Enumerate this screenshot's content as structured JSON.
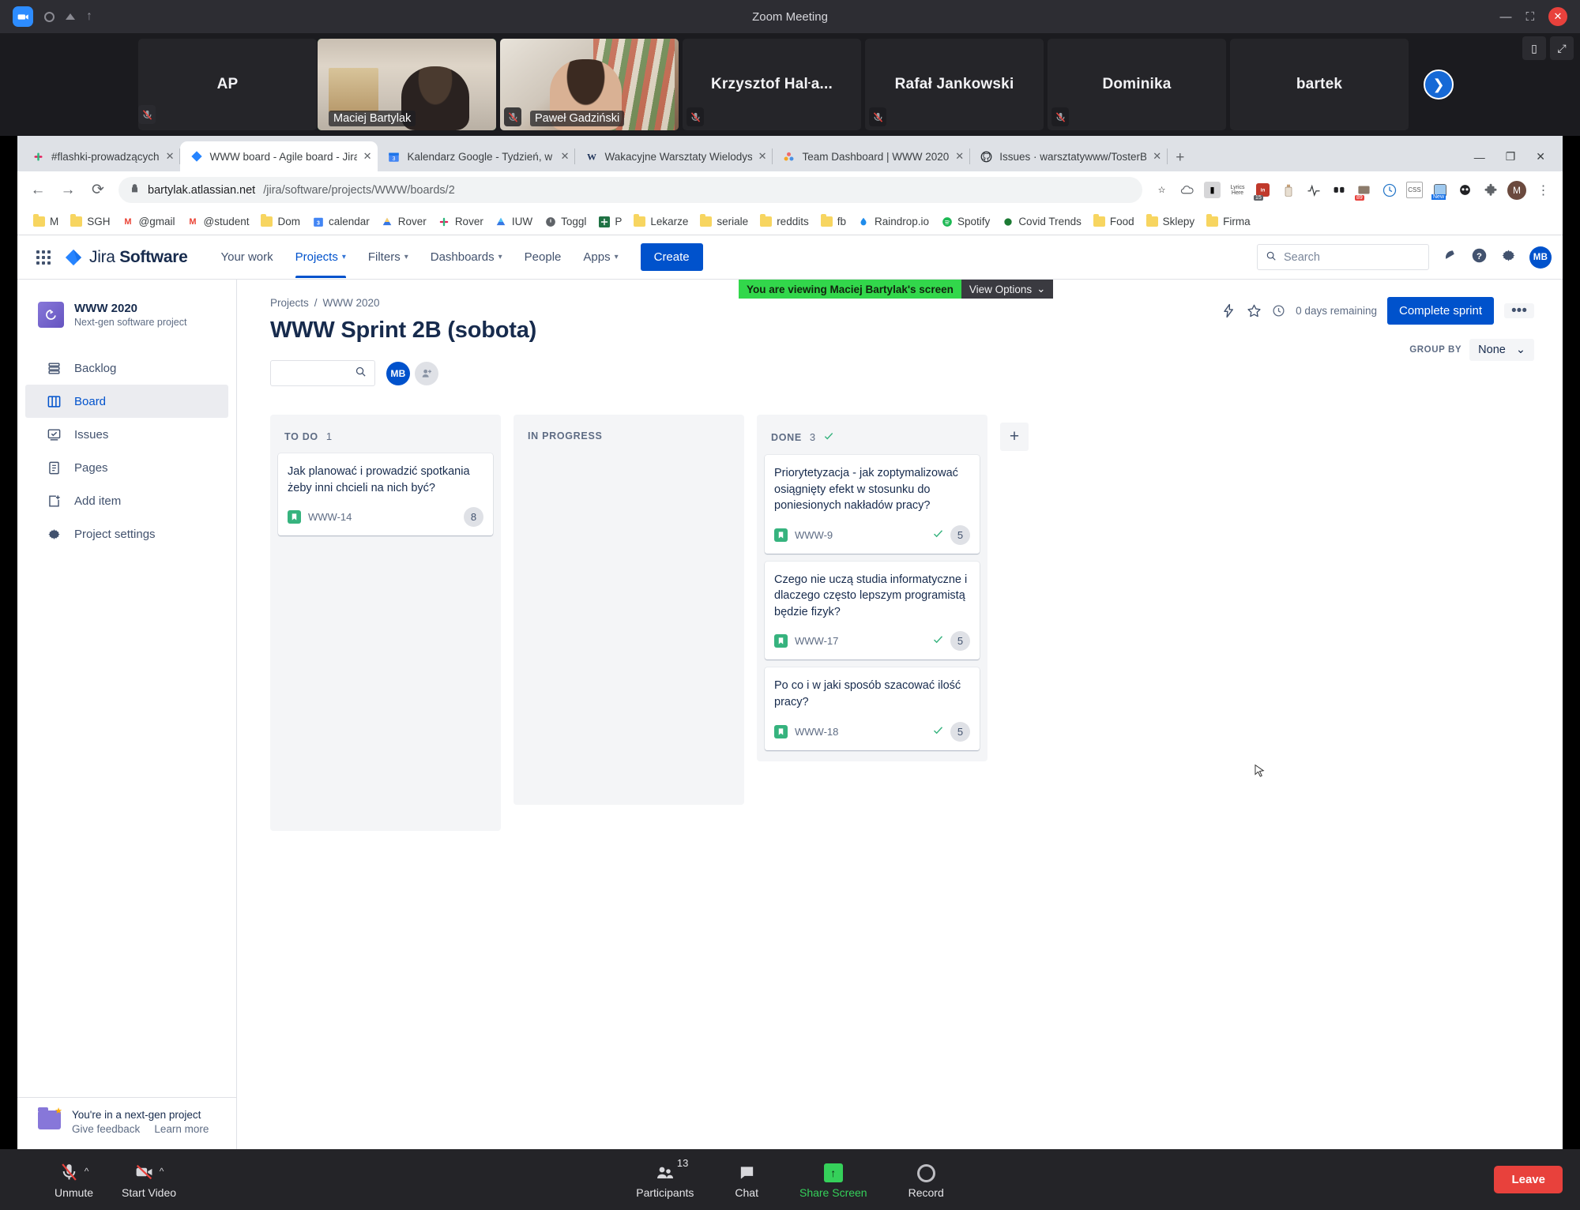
{
  "zoom": {
    "window_title": "Zoom Meeting",
    "participants": [
      {
        "name": "AP",
        "has_video": false,
        "muted": true
      },
      {
        "name": "Maciej Bartylak",
        "has_video": true,
        "muted": false,
        "active_speaker": true
      },
      {
        "name": "Paweł Gadziński",
        "has_video": true,
        "muted": true
      },
      {
        "name": "Krzysztof Haŀa...",
        "has_video": false,
        "muted": true
      },
      {
        "name": "Rafał Jankowski",
        "has_video": false,
        "muted": true
      },
      {
        "name": "Dominika",
        "has_video": false,
        "muted": true
      },
      {
        "name": "bartek",
        "has_video": false,
        "muted": true
      }
    ],
    "next_page_icon": "chevron-right-icon",
    "view_banner": {
      "text": "You are viewing Maciej Bartylak's screen",
      "options_label": "View Options",
      "accent_color": "#32d74b"
    },
    "bottom_bar": {
      "unmute_label": "Unmute",
      "start_video_label": "Start Video",
      "participants_label": "Participants",
      "participants_count": "13",
      "chat_label": "Chat",
      "share_screen_label": "Share Screen",
      "record_label": "Record",
      "leave_label": "Leave",
      "leave_color": "#e8413c",
      "share_color": "#35d05a"
    }
  },
  "browser": {
    "tabs": [
      {
        "title": "#flashki-prowadzących",
        "favicon": "slack-icon",
        "active": false
      },
      {
        "title": "WWW board - Agile board - Jira",
        "favicon": "jira-icon",
        "active": true
      },
      {
        "title": "Kalendarz Google - Tydzień, w kt",
        "favicon": "google-calendar-icon",
        "active": false
      },
      {
        "title": "Wakacyjne Warsztaty Wielodyscy",
        "favicon": "wordpress-icon",
        "active": false
      },
      {
        "title": "Team Dashboard | WWW 2020",
        "favicon": "asana-icon",
        "active": false
      },
      {
        "title": "Issues · warsztatywww/TosterBot",
        "favicon": "github-icon",
        "active": false
      }
    ],
    "new_tab_label": "+",
    "address": {
      "host": "bartylak.atlassian.net",
      "path": "/jira/software/projects/WWW/boards/2",
      "lock_icon": "lock-icon"
    },
    "nav_icons": [
      "back-arrow-icon",
      "forward-arrow-icon",
      "reload-icon"
    ],
    "bookmarks": [
      {
        "label": "M",
        "icon": "folder-icon"
      },
      {
        "label": "SGH",
        "icon": "folder-icon"
      },
      {
        "label": "@gmail",
        "icon": "gmail-icon"
      },
      {
        "label": "@student",
        "icon": "gmail-icon"
      },
      {
        "label": "Dom",
        "icon": "folder-icon"
      },
      {
        "label": "calendar",
        "icon": "google-calendar-icon"
      },
      {
        "label": "Rover",
        "icon": "google-drive-icon"
      },
      {
        "label": "Rover",
        "icon": "slack-icon"
      },
      {
        "label": "IUW",
        "icon": "google-drive-icon"
      },
      {
        "label": "Toggl",
        "icon": "toggl-icon"
      },
      {
        "label": "P",
        "icon": "excel-icon"
      },
      {
        "label": "Lekarze",
        "icon": "folder-icon"
      },
      {
        "label": "seriale",
        "icon": "folder-icon"
      },
      {
        "label": "reddits",
        "icon": "folder-icon"
      },
      {
        "label": "fb",
        "icon": "folder-icon"
      },
      {
        "label": "Raindrop.io",
        "icon": "raindrop-icon"
      },
      {
        "label": "Spotify",
        "icon": "spotify-icon"
      },
      {
        "label": "Covid Trends",
        "icon": "covid-icon"
      },
      {
        "label": "Food",
        "icon": "folder-icon"
      },
      {
        "label": "Sklepy",
        "icon": "folder-icon"
      },
      {
        "label": "Firma",
        "icon": "folder-icon"
      }
    ],
    "profile_initial": "M",
    "window_controls": [
      "minimize",
      "restore",
      "close"
    ]
  },
  "jira": {
    "logo_text_light": "Jira ",
    "logo_text_bold": "Software",
    "nav": [
      {
        "label": "Your work",
        "has_caret": false,
        "selected": false
      },
      {
        "label": "Projects",
        "has_caret": true,
        "selected": true
      },
      {
        "label": "Filters",
        "has_caret": true,
        "selected": false
      },
      {
        "label": "Dashboards",
        "has_caret": true,
        "selected": false
      },
      {
        "label": "People",
        "has_caret": false,
        "selected": false
      },
      {
        "label": "Apps",
        "has_caret": true,
        "selected": false
      }
    ],
    "create_label": "Create",
    "search_placeholder": "Search",
    "nav_icons": [
      "notification-bell-icon",
      "help-icon",
      "settings-gear-icon"
    ],
    "user_initials": "MB",
    "accent_color": "#0052cc",
    "sidebar": {
      "project_name": "WWW 2020",
      "project_type": "Next-gen software project",
      "items": [
        {
          "label": "Backlog",
          "icon": "backlog-icon",
          "selected": false
        },
        {
          "label": "Board",
          "icon": "board-icon",
          "selected": true
        },
        {
          "label": "Issues",
          "icon": "issues-icon",
          "selected": false
        },
        {
          "label": "Pages",
          "icon": "pages-icon",
          "selected": false
        },
        {
          "label": "Add item",
          "icon": "add-item-icon",
          "selected": false
        },
        {
          "label": "Project settings",
          "icon": "settings-gear-icon",
          "selected": false
        }
      ],
      "footer": {
        "title": "You're in a next-gen project",
        "feedback_link": "Give feedback",
        "learn_link": "Learn more"
      }
    },
    "breadcrumbs": [
      "Projects",
      "WWW 2020"
    ],
    "board_title": "WWW Sprint 2B (sobota)",
    "board_search_placeholder": "",
    "avatars": [
      "MB"
    ],
    "add_people_icon": "add-person-icon",
    "header_actions": {
      "insights_icon": "lightning-icon",
      "star_icon": "star-icon",
      "clock_icon": "clock-icon",
      "days_remaining": "0 days remaining",
      "complete_sprint_label": "Complete sprint",
      "more_label": "•••"
    },
    "group_by": {
      "label": "GROUP BY",
      "value": "None"
    },
    "add_column_label": "+",
    "columns": [
      {
        "name": "TO DO",
        "count": "1",
        "done_check": false,
        "cards": [
          {
            "title": "Jak planować i prowadzić spotkania żeby inni chcieli na nich być?",
            "key": "WWW-14",
            "points": "8",
            "done": false
          }
        ]
      },
      {
        "name": "IN PROGRESS",
        "count": "",
        "done_check": false,
        "cards": []
      },
      {
        "name": "DONE",
        "count": "3",
        "done_check": true,
        "cards": [
          {
            "title": "Priorytetyzacja - jak zoptymalizować osiągnięty efekt w stosunku do poniesionych nakładów pracy?",
            "key": "WWW-9",
            "points": "5",
            "done": true
          },
          {
            "title": "Czego nie uczą studia informatyczne i dlaczego często lepszym programistą będzie fizyk?",
            "key": "WWW-17",
            "points": "5",
            "done": true
          },
          {
            "title": "Po co i w jaki sposób szacować ilość pracy?",
            "key": "WWW-18",
            "points": "5",
            "done": true
          }
        ]
      }
    ]
  }
}
